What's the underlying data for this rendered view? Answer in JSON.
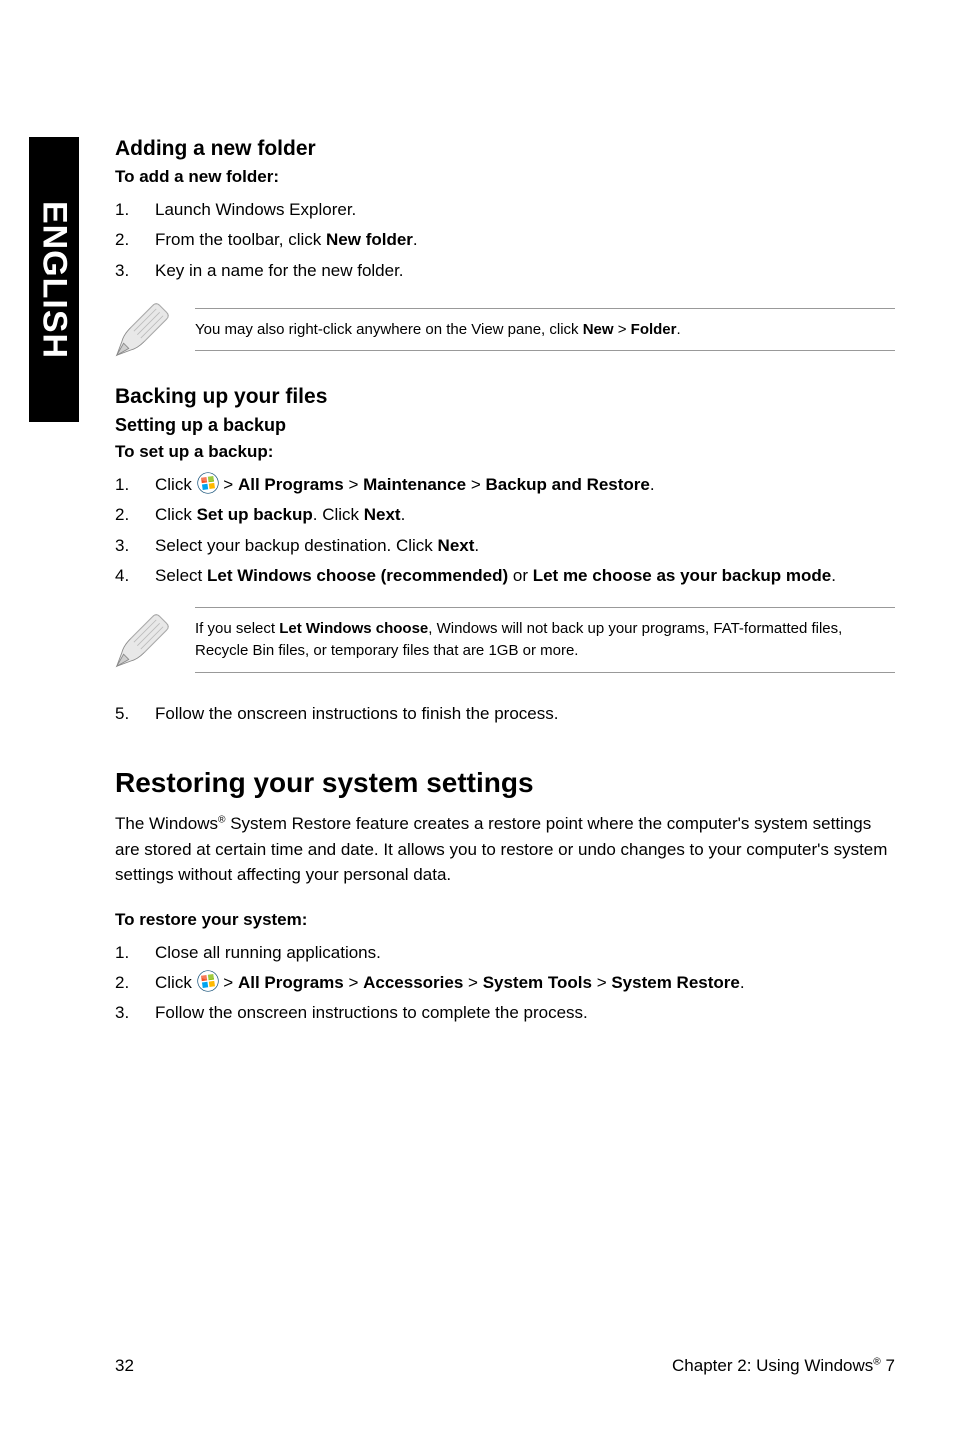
{
  "sidetab": "ENGLISH",
  "addFolder": {
    "heading": "Adding a new folder",
    "lead": "To add a new folder:",
    "s1": "Launch Windows Explorer.",
    "s2_a": "From the toolbar, click ",
    "s2_b": "New folder",
    "s2_c": ".",
    "s3": "Key in a name for the new folder.",
    "note_a": "You may also right-click anywhere on the View pane, click ",
    "note_b": "New",
    "note_c": " > ",
    "note_d": "Folder",
    "note_e": "."
  },
  "backup": {
    "heading": "Backing up your files",
    "sub": "Setting up a backup",
    "lead": "To set up a backup:",
    "s1_a": "Click ",
    "s1_b": " > ",
    "s1_c": "All Programs",
    "s1_d": " > ",
    "s1_e": "Maintenance",
    "s1_f": " > ",
    "s1_g": "Backup and Restore",
    "s1_h": ".",
    "s2_a": "Click ",
    "s2_b": "Set up backup",
    "s2_c": ". Click ",
    "s2_d": "Next",
    "s2_e": ".",
    "s3_a": "Select your backup destination. Click ",
    "s3_b": "Next",
    "s3_c": ".",
    "s4_a": "Select ",
    "s4_b": "Let Windows choose (recommended)",
    "s4_c": " or ",
    "s4_d": "Let me choose as your backup mode",
    "s4_e": ".",
    "note_a": "If you select ",
    "note_b": "Let Windows choose",
    "note_c": ", Windows will not back up your programs, FAT-formatted files, Recycle Bin files, or temporary files that are 1GB or more.",
    "s5": "Follow the onscreen instructions to finish the process."
  },
  "restore": {
    "heading": "Restoring your system settings",
    "body_a": "The Windows",
    "body_b": " System Restore feature creates a restore point where the computer's system settings are stored at certain time and date. It allows you to restore or undo changes to your computer's system settings without affecting your personal data.",
    "lead": "To restore your system:",
    "s1": "Close all running applications.",
    "s2_a": "Click ",
    "s2_b": " > ",
    "s2_c": "All Programs",
    "s2_d": " > ",
    "s2_e": "Accessories",
    "s2_f": " > ",
    "s2_g": "System Tools",
    "s2_h": " > ",
    "s2_i": "System Restore",
    "s2_j": ".",
    "s3": "Follow the onscreen instructions to complete the process."
  },
  "footer": {
    "page": "32",
    "chapter_a": "Chapter 2: Using Windows",
    "chapter_b": " 7"
  }
}
